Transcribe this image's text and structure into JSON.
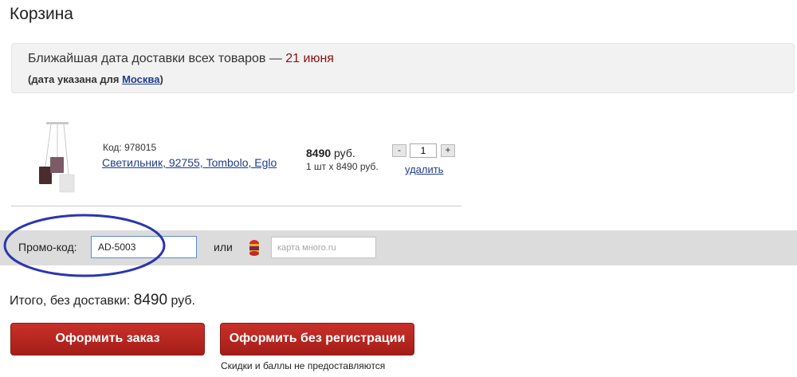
{
  "page": {
    "title": "Корзина"
  },
  "delivery": {
    "text": "Ближайшая дата доставки всех товаров — ",
    "date": "21 июня",
    "note_prefix": "(дата указана для ",
    "city": "Москва",
    "note_suffix": ")"
  },
  "cart_item": {
    "code": "Код: 978015",
    "name": "Светильник, 92755, Tombolo, Eglo",
    "price": "8490",
    "currency": " руб.",
    "unit_price": "1 шт x 8490 руб.",
    "quantity": "1",
    "minus_label": "-",
    "plus_label": "+",
    "delete_label": "удалить"
  },
  "promo": {
    "label": "Промо-код:",
    "value": "AD-5003",
    "or_label": "или",
    "card_placeholder": "карта много.ru"
  },
  "total": {
    "label": "Итого, без доставки: ",
    "amount": "8490",
    "currency": " руб."
  },
  "buttons": {
    "order": "Оформить заказ",
    "no_registration": "Оформить без регистрации",
    "no_registration_note": "Скидки и баллы не предоставляются"
  },
  "colors": {
    "accent_red": "#b2241e",
    "link_blue": "#1e3d8f",
    "annotation": "#2a36b0"
  }
}
